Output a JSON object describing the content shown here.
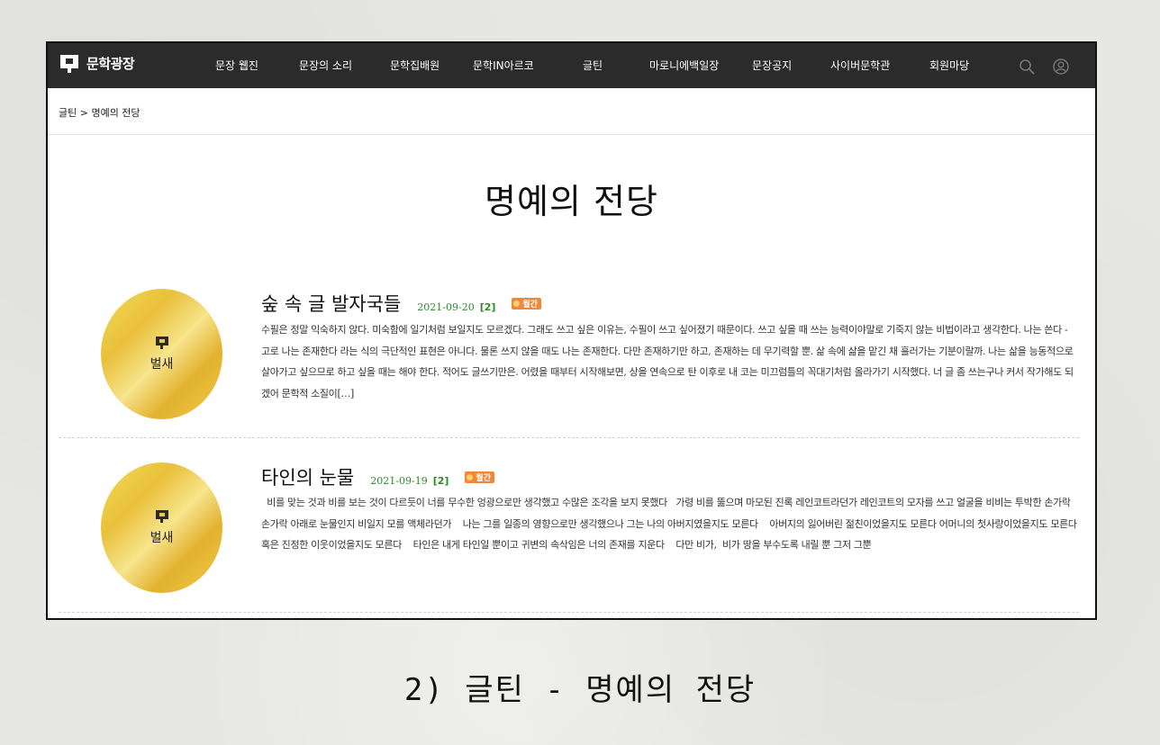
{
  "header": {
    "logo_text": "문학광장",
    "menu": [
      {
        "label": "문장 웹진"
      },
      {
        "label": "문장의 소리"
      },
      {
        "label": "문학집배원"
      },
      {
        "label": "문학IN아르코"
      },
      {
        "label": "글틴"
      },
      {
        "label": "마로니에백일장"
      },
      {
        "label": "문장공지"
      },
      {
        "label": "사이버문학관"
      },
      {
        "label": "회원마당"
      }
    ],
    "icons": [
      "search-icon",
      "user-icon"
    ]
  },
  "breadcrumb": "글틴 > 명예의 전당",
  "page_title": "명예의 전당",
  "entries": [
    {
      "title": "숲 속 글 발자국들",
      "date": "2021-09-20",
      "comments": "[2]",
      "badge": "월간",
      "medal_label": "벌새",
      "body": "수필은 정말 익숙하지 않다. 미숙함에 일기처럼 보일지도 모르겠다.  그래도 쓰고 싶은 이유는, 수필이 쓰고 싶어졌기 때문이다. 쓰고 싶을 때 쓰는 능력이야말로 기죽지 않는 비법이라고 생각한다. 나는 쓴다 - 고로 나는 존재한다 라는 식의 극단적인 표현은 아니다. 물론 쓰지 않을 때도 나는 존재한다. 다만 존재하기만 하고, 존재하는 데 무기력할 뿐. 삶 속에 삶을 맡긴 채 흘러가는 기분이랄까. 나는 삶을 능동적으로 살아가고 싶으므로 하고 싶을 때는 해야 한다. 적어도 글쓰기만은.  어렸을 때부터 시작해보면,  상을 연속으로 탄 이후로 내 코는 미끄럼틀의 꼭대기처럼 올라가기 시작했다. 너 글 좀 쓰는구나 커서 작가해도 되겠어 문학적 소질이[…]"
    },
    {
      "title": "타인의 눈물",
      "date": "2021-09-19",
      "comments": "[2]",
      "badge": "월간",
      "medal_label": "벌새",
      "body": "  비를 맞는 것과 비를 보는 것이 다르듯이 너를 무수한 엉광으로만 생각했고 수많은 조각을 보지 못했다   가령 비를 뚫으며 마모된 진록 레인코트라던가 레인코트의 모자를 쓰고 얼굴을 비비는 투박한 손가락 손가락 아래로 눈물인지 비일지 모를 액체라던가    나는 그를 일종의 영향으로만 생각했으나 그는 나의 아버지였을지도 모른다    아버지의 잃어버린 젊친이었을지도 모른다 어머니의 첫사랑이었을지도 모른다 혹은 진정한 이웃이었을지도 모른다    타인은 내게 타인일 뿐이고 귀변의 속삭임은 너의 존재를 지운다    다만 비가,  비가 땅을 부수도록 내릴 뿐 그저 그뿐"
    }
  ],
  "caption": "2) 글틴 - 명예의 전당"
}
